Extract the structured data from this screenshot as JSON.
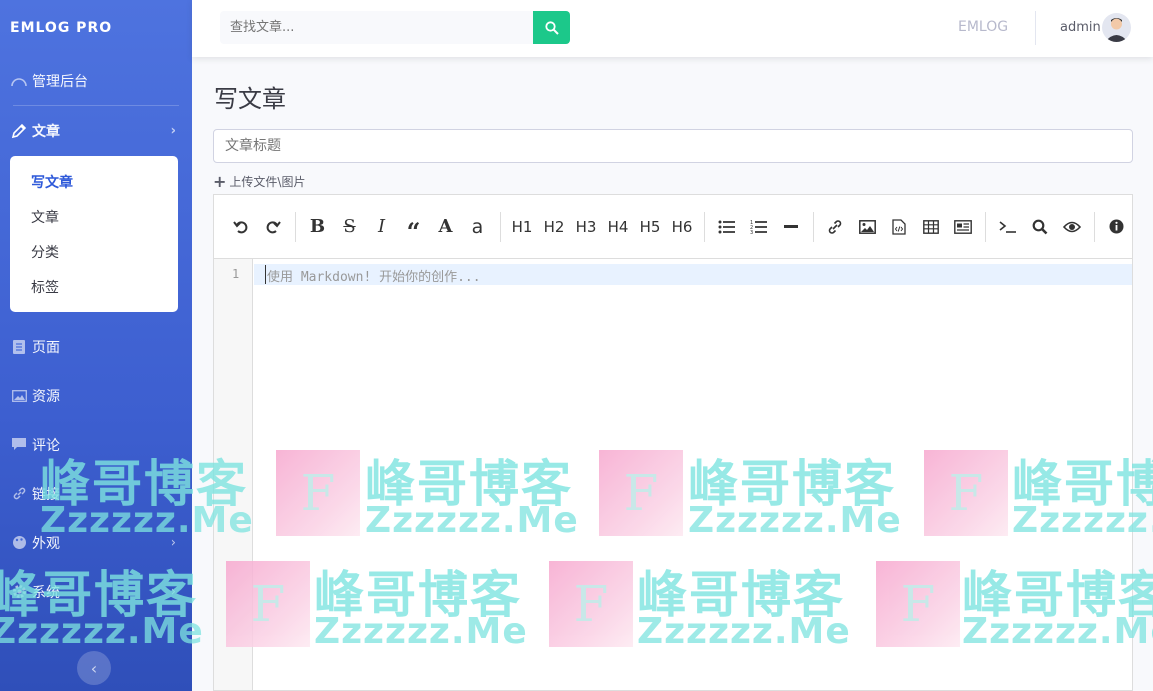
{
  "sidebar": {
    "brand": "EMLOG PRO",
    "items": [
      {
        "label": "管理后台",
        "icon": "dashboard-icon"
      },
      {
        "label": "文章",
        "icon": "pencil-icon"
      },
      {
        "label": "页面",
        "icon": "page-icon"
      },
      {
        "label": "资源",
        "icon": "image-icon"
      },
      {
        "label": "评论",
        "icon": "comment-icon"
      },
      {
        "label": "链接",
        "icon": "link-icon"
      },
      {
        "label": "外观",
        "icon": "palette-icon"
      },
      {
        "label": "系统",
        "icon": "gear-icon"
      }
    ],
    "submenu": [
      "写文章",
      "文章",
      "分类",
      "标签"
    ],
    "collapse_glyph": "‹"
  },
  "topbar": {
    "search_placeholder": "查找文章...",
    "site_link": "EMLOG",
    "username": "admin"
  },
  "main": {
    "page_title": "写文章",
    "title_placeholder": "文章标题",
    "upload_label": "上传文件\\图片",
    "editor": {
      "line_number": "1",
      "placeholder": "使用 Markdown! 开始你的创作...",
      "headings": [
        "H1",
        "H2",
        "H3",
        "H4",
        "H5",
        "H6"
      ]
    }
  },
  "watermark": {
    "letter": "F",
    "name": "峰哥博客",
    "url": "Zzzzzz.Me"
  },
  "colors": {
    "sidebar": "#4e73df",
    "search_button": "#1cc88a",
    "active_submenu": "#2e59d9"
  }
}
